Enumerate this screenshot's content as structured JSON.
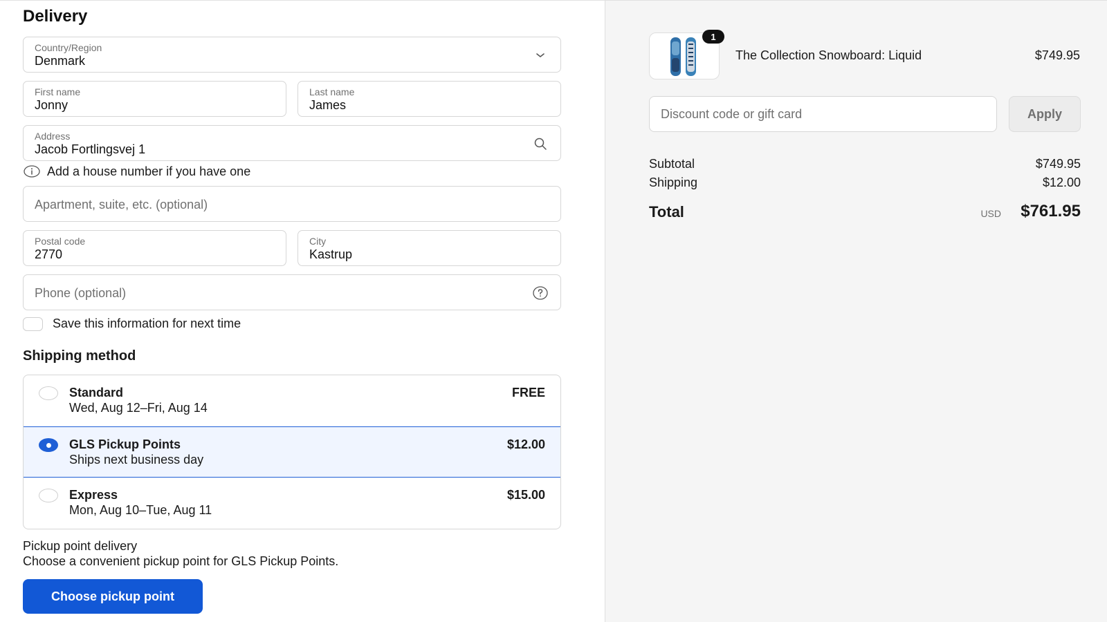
{
  "delivery": {
    "title": "Delivery",
    "country": {
      "label": "Country/Region",
      "value": "Denmark",
      "icon": "chevron-down-icon"
    },
    "first_name": {
      "label": "First name",
      "value": "Jonny"
    },
    "last_name": {
      "label": "Last name",
      "value": "James"
    },
    "address": {
      "label": "Address",
      "value": "Jacob Fortlingsvej 1",
      "icon": "search-icon"
    },
    "address_hint": "Add a house number if you have one",
    "apartment": {
      "placeholder": "Apartment, suite, etc. (optional)"
    },
    "postal_code": {
      "label": "Postal code",
      "value": "2770"
    },
    "city": {
      "label": "City",
      "value": "Kastrup"
    },
    "phone": {
      "placeholder": "Phone (optional)",
      "icon": "help-icon"
    },
    "save_info": "Save this information for next time"
  },
  "shipping": {
    "title": "Shipping method",
    "options": [
      {
        "name": "Standard",
        "desc": "Wed, Aug 12–Fri, Aug 14",
        "price": "FREE",
        "selected": false
      },
      {
        "name": "GLS Pickup Points",
        "desc": "Ships next business day",
        "price": "$12.00",
        "selected": true
      },
      {
        "name": "Express",
        "desc": "Mon, Aug 10–Tue, Aug 11",
        "price": "$15.00",
        "selected": false
      }
    ],
    "pickup_title": "Pickup point delivery",
    "pickup_desc": "Choose a convenient pickup point for GLS Pickup Points.",
    "pickup_button": "Choose pickup point"
  },
  "summary": {
    "product": {
      "name": "The Collection Snowboard: Liquid",
      "price": "$749.95",
      "quantity": "1"
    },
    "discount": {
      "placeholder": "Discount code or gift card",
      "button": "Apply"
    },
    "subtotal_label": "Subtotal",
    "subtotal_value": "$749.95",
    "shipping_label": "Shipping",
    "shipping_value": "$12.00",
    "total_label": "Total",
    "currency": "USD",
    "total_value": "$761.95"
  },
  "colors": {
    "accent": "#1258d6",
    "selected_bg": "#f0f5ff",
    "panel_bg": "#f5f5f5"
  }
}
